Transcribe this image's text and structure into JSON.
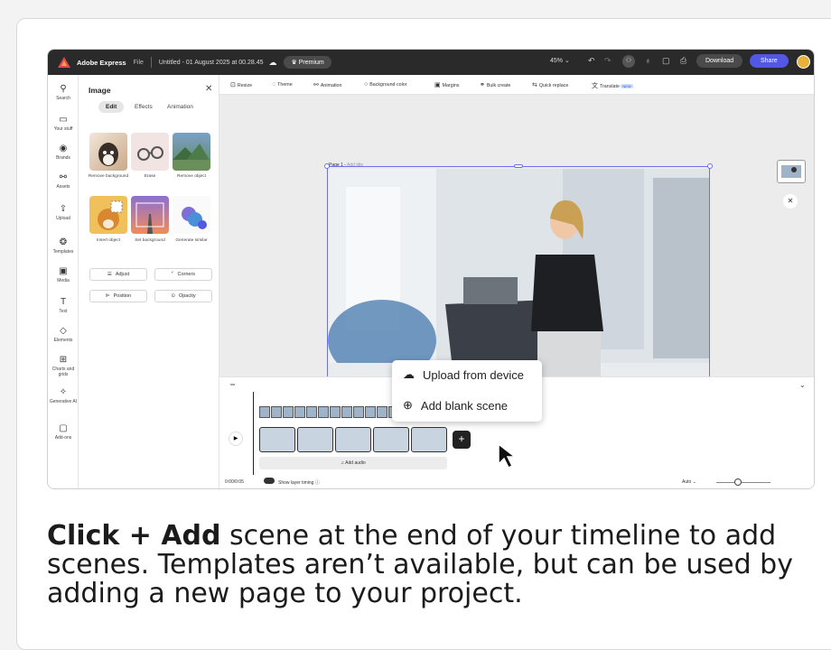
{
  "topbar": {
    "app_name": "Adobe Express",
    "file_menu": "File",
    "doc_title": "Untitled - 01 August 2025 at 00.28.45",
    "premium": "Premium",
    "zoom": "45%",
    "download": "Download",
    "share": "Share"
  },
  "rail": {
    "items": [
      "Search",
      "Your stuff",
      "Brands",
      "Assets",
      "Upload",
      "Templates",
      "Media",
      "Text",
      "Elements",
      "Charts and grids",
      "Generative AI",
      "Add-ons"
    ]
  },
  "panel": {
    "title": "Image",
    "tabs": [
      "Edit",
      "Effects",
      "Animation"
    ],
    "tiles": [
      "Remove background",
      "Erase",
      "Remove object",
      "Insert object",
      "Set background",
      "Generate similar"
    ],
    "buttons": [
      "Adjust",
      "Corners",
      "Position",
      "Opacity"
    ]
  },
  "toolbar": {
    "tools": [
      "Resize",
      "Theme",
      "Animation",
      "Background color",
      "Margins",
      "Bulk create",
      "Quick replace",
      "Translate"
    ],
    "new_badge": "NEW"
  },
  "canvas": {
    "page_label": "Page 1 -",
    "page_placeholder": "Add title"
  },
  "timeline": {
    "add_audio": "Add audio",
    "timecode": "0:00/0:05",
    "show_layer_timing": "Show layer timing",
    "auto": "Auto",
    "plus": "+"
  },
  "popup_menu": {
    "upload": "Upload from device",
    "add_blank": "Add blank scene"
  },
  "caption": {
    "bold": "Click + Add",
    "rest": " scene at the end of your timeline to add scenes. Templates aren’t available, but can be used by adding a new page to your project."
  },
  "colors": {
    "topbar": "#2a2a2a",
    "share": "#5258e4",
    "selection": "#6b6ff0",
    "canvas_bg": "#ececec"
  }
}
